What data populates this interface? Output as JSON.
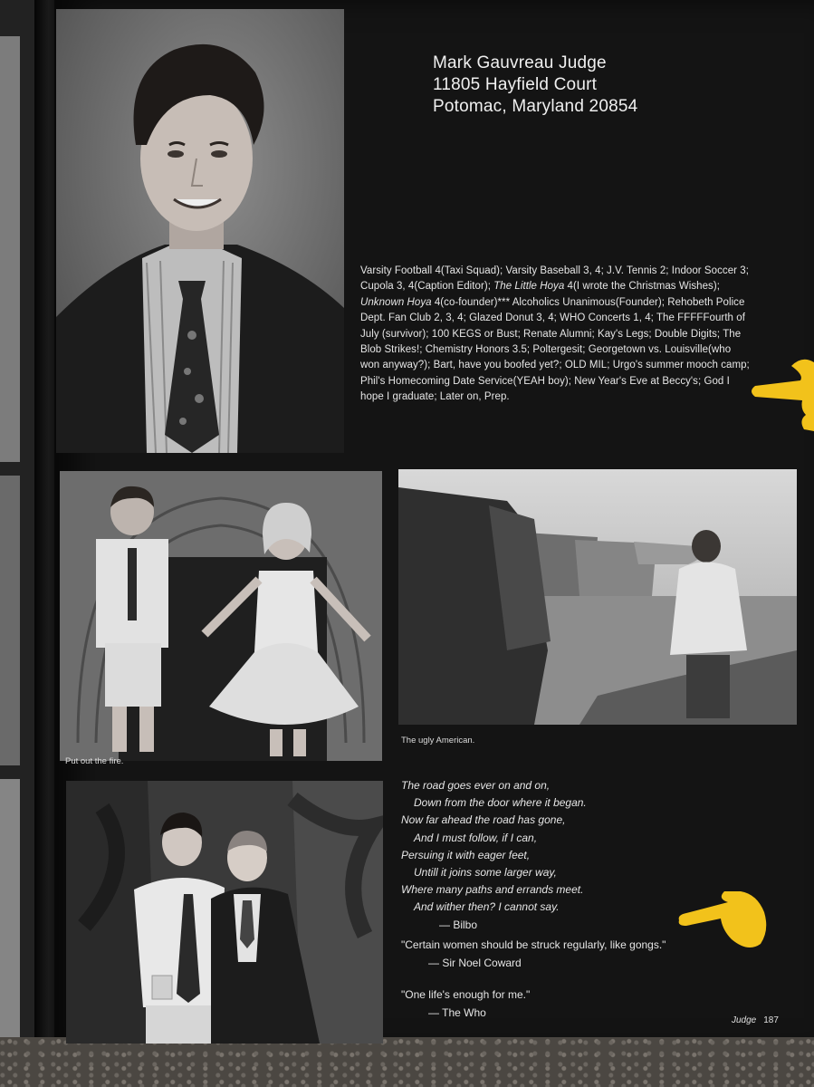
{
  "header": {
    "name": "Mark Gauvreau Judge",
    "street": "11805 Hayfield Court",
    "city": "Potomac, Maryland 20854"
  },
  "activities": [
    {
      "t": "Varsity Football 4(Taxi Squad); Varsity Baseball 3, 4; J.V. Tennis 2; Indoor Soccer 3; Cupola 3, 4(Caption Editor); "
    },
    {
      "t": "The Little Hoya",
      "i": true
    },
    {
      "t": " 4(I wrote the Christmas Wishes); "
    },
    {
      "t": "Unknown Hoya",
      "i": true
    },
    {
      "t": " 4(co-founder)*** Alcoholics Unanimous(Founder); Rehobeth Police Dept. Fan Club 2, 3, 4; Glazed Donut 3, 4; WHO Concerts 1, 4; The FFFFFourth of July (survivor); 100 KEGS or Bust; Renate Alumni; Kay's Legs; Double Digits; The Blob Strikes!; Chemistry Honors 3.5; Poltergesit; Georgetown vs. Louisville(who won anyway?); Bart, have you boofed yet?; OLD MIL; Urgo's summer mooch camp; Phil's Homecoming Date Service(YEAH boy); New Year's Eve at Beccy's; God I hope I graduate; Later on, Prep."
    }
  ],
  "captions": {
    "fireplace": "Put out the fire.",
    "cliffs": "The ugly American."
  },
  "poem": {
    "lines": [
      "The road goes ever on and on,",
      "Down from the door where it began.",
      "Now far ahead the road has gone,",
      "And I must follow, if I can,",
      "Persuing it with eager feet,",
      "Untill it joins some larger way,",
      "Where many paths and errands meet.",
      "And wither then? I cannot say."
    ],
    "attribution": "— Bilbo"
  },
  "quotes": [
    {
      "text": "\"Certain women should be struck regularly, like gongs.\"",
      "author": "— Sir Noel Coward"
    },
    {
      "text": "\"One life's enough for me.\"",
      "author": "— The Who"
    }
  ],
  "footer": {
    "section": "Judge",
    "page_number": "187"
  },
  "colors": {
    "page": "#141414",
    "highlight_pointer": "#f2c21b"
  }
}
